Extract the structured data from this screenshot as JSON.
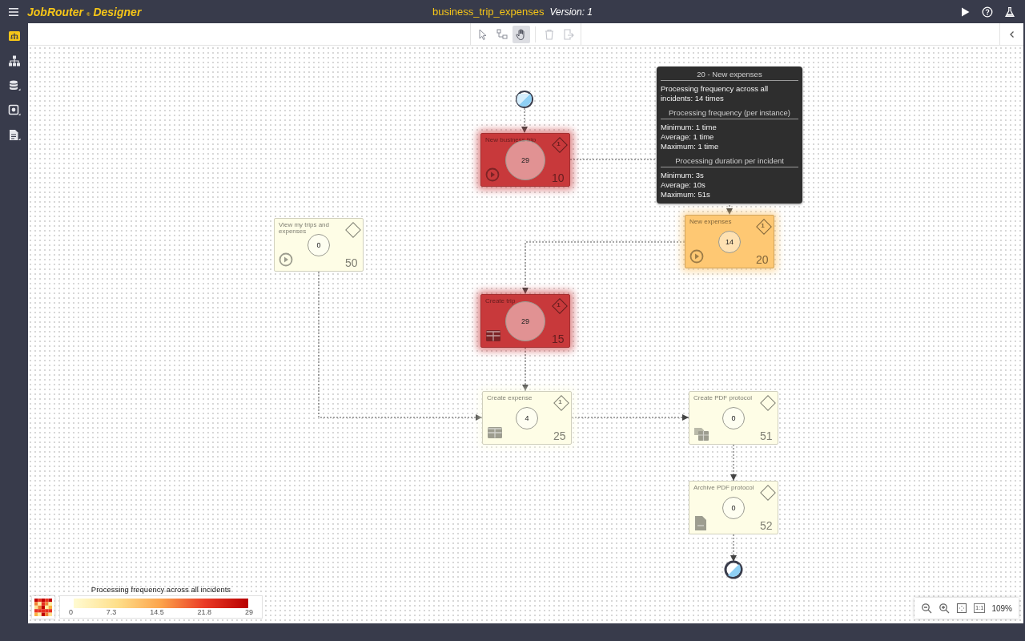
{
  "header": {
    "logo": "JobRouter",
    "logo_mark": "®",
    "product": "Designer",
    "process_name": "business_trip_expenses",
    "version": "Version: 1"
  },
  "sidebar": {
    "items": [
      {
        "kind": "dashboard",
        "selected": true
      },
      {
        "kind": "hierarchy",
        "selected": false
      },
      {
        "kind": "database",
        "selected": false
      },
      {
        "kind": "module",
        "selected": false
      },
      {
        "kind": "document",
        "selected": false
      }
    ]
  },
  "toolbar": {
    "tools": [
      {
        "kind": "select",
        "selected": false,
        "disabled": false
      },
      {
        "kind": "connect",
        "selected": false,
        "disabled": false
      },
      {
        "kind": "pan",
        "selected": true,
        "disabled": false
      },
      {
        "kind": "delete",
        "selected": false,
        "disabled": true
      },
      {
        "kind": "export",
        "selected": false,
        "disabled": true
      }
    ]
  },
  "diagram": {
    "steps": [
      {
        "label": "New business trip",
        "number": "10",
        "count": "29",
        "max": true,
        "color": "#c8393b",
        "glow": true,
        "kind": "start",
        "badge": "1"
      },
      {
        "label": "View my trips and expenses",
        "number": "50",
        "count": "0",
        "max": false,
        "color": "#fefde6",
        "glow": false,
        "kind": "start"
      },
      {
        "label": "New expenses",
        "number": "20",
        "count": "14",
        "max": false,
        "color": "#fec873",
        "glow": true,
        "kind": "start",
        "badge": "1"
      },
      {
        "label": "Create trip",
        "number": "15",
        "count": "29",
        "max": true,
        "color": "#c8393b",
        "glow": true,
        "kind": "form",
        "badge": "1"
      },
      {
        "label": "Create expense",
        "number": "25",
        "count": "4",
        "max": false,
        "color": "#fefde6",
        "glow": true,
        "kind": "form",
        "badge": "1"
      },
      {
        "label": "Create PDF protocol",
        "number": "51",
        "count": "0",
        "max": false,
        "color": "#fefde6",
        "glow": false,
        "kind": "pdf"
      },
      {
        "label": "Archive PDF protocol",
        "number": "52",
        "count": "0",
        "max": false,
        "color": "#fefde6",
        "glow": false,
        "kind": "archive"
      }
    ]
  },
  "tooltip": {
    "title": "20 - New expenses",
    "summary": "Processing frequency across all incidents: 14 times",
    "sections": [
      {
        "heading": "Processing frequency (per instance)",
        "lines": [
          "Minimum: 1 time",
          "Average: 1 time",
          "Maximum: 1 time"
        ]
      },
      {
        "heading": "Processing duration per incident",
        "lines": [
          "Minimum: 3s",
          "Average: 10s",
          "Maximum: 51s"
        ]
      }
    ]
  },
  "legend": {
    "title": "Processing frequency across all incidents",
    "ticks": [
      "0",
      "7.3",
      "14.5",
      "21.8",
      "29"
    ]
  },
  "zoom": {
    "actual_size": "1:1",
    "level_text": "109%"
  }
}
